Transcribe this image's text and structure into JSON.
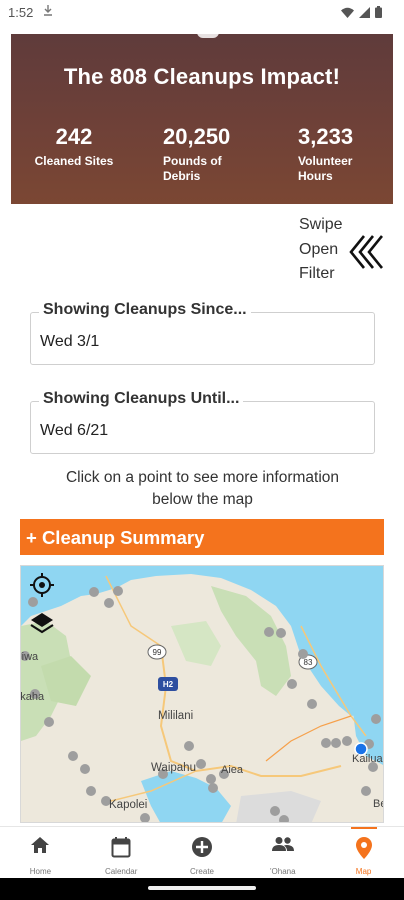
{
  "status_bar": {
    "time": "1:52",
    "download_icon": "download-arrow-icon",
    "icons": [
      "wifi-icon",
      "cell-signal-icon",
      "battery-icon"
    ]
  },
  "impact": {
    "title": "The 808 Cleanups Impact!",
    "stats": [
      {
        "value": "242",
        "label": "Cleaned Sites"
      },
      {
        "value": "20,250",
        "label_lines": [
          "Pounds of",
          "Debris"
        ]
      },
      {
        "value": "3,233",
        "label_lines": [
          "Volunteer",
          "Hours"
        ]
      }
    ]
  },
  "filter": {
    "swipe_lines": [
      "Swipe",
      "Open",
      "Filter"
    ],
    "icon": "double-chevron-left-icon"
  },
  "since": {
    "label": "Showing Cleanups Since...",
    "value": "Wed 3/1"
  },
  "until": {
    "label": "Showing Cleanups Until...",
    "value": "Wed 6/21"
  },
  "hint_lines": [
    "Click on a point to see more information",
    "below the map"
  ],
  "summary": {
    "label": "+ Cleanup Summary"
  },
  "map": {
    "labels": {
      "mililani": "Mililani",
      "waipahu": "Waipahu",
      "aiea": "Aiea",
      "kapolei": "Kapolei",
      "kailua": "Kailua",
      "haleiwa": "Haleiwa",
      "makaha": "Makaha",
      "hwy_99": "99",
      "hwy_h2": "H2",
      "hwy_83": "83",
      "be": "Be"
    }
  },
  "nav": {
    "items": [
      {
        "label": "Home",
        "icon": "home-icon"
      },
      {
        "label": "Calendar",
        "icon": "calendar-icon"
      },
      {
        "label": "Create",
        "icon": "plus-circle-icon"
      },
      {
        "label": "'Ohana",
        "icon": "people-icon"
      },
      {
        "label": "Map",
        "icon": "map-pin-icon"
      }
    ],
    "active": "Map"
  },
  "colors": {
    "header_bg": "#6f4138",
    "accent": "#f4731d",
    "map_water": "#8fd6f2",
    "map_land": "#ede8dc",
    "point": "#9e9e9e",
    "location_dot": "#1a73e8"
  }
}
